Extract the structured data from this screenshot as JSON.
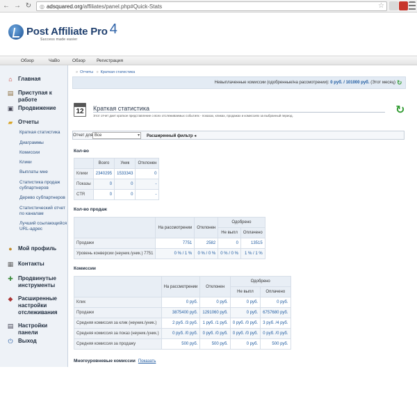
{
  "browser": {
    "url_host": "adsquared.org",
    "url_path": "/affiliates/panel.php#Quick-Stats",
    "back_glyph": "←",
    "forward_glyph": "→",
    "reload_glyph": "↻"
  },
  "header": {
    "logo_text": "Post Affiliate Pro",
    "logo_version": "4",
    "logo_tagline": "Success made easier",
    "nav": [
      "Обзор",
      "ЧаВо",
      "Обзор",
      "Регистрация"
    ]
  },
  "sidebar": {
    "items": [
      {
        "label": "Главная",
        "icon": "home-icon"
      },
      {
        "label": "Приступая к работе",
        "icon": "book-icon"
      },
      {
        "label": "Продвижение",
        "icon": "monitor-icon"
      },
      {
        "label": "Отчеты",
        "icon": "folder-icon"
      },
      {
        "label": "Мой профиль",
        "icon": "user-icon"
      },
      {
        "label": "Контакты",
        "icon": "contacts-icon"
      },
      {
        "label": "Продвинутые инструменты",
        "icon": "tools-icon"
      },
      {
        "label": "Расширенные настройки отслеживания",
        "icon": "tracking-icon"
      },
      {
        "label": "Настройки панели",
        "icon": "settings-icon"
      },
      {
        "label": "Выход",
        "icon": "logout-icon"
      }
    ],
    "reports_sub": [
      "Краткая статистика",
      "Диаграммы",
      "Комиссии",
      "Клики",
      "Выплаты мне",
      "Статистика продаж субпартнеров",
      "Дерево субпартнеров",
      "Статистический отчет по каналам",
      "Лучший ссылающийся URL-адрес"
    ]
  },
  "main": {
    "breadcrumb": [
      "Отчеты",
      "Краткая статистика"
    ],
    "pending_label": "Невыплаченные комиссии (одобренные/на рассмотрении):",
    "pending_value": "0 руб. / 101000 руб.",
    "pending_period": "(Этот месяц)",
    "calendar_day": "12",
    "title": "Краткая статистика",
    "description": "Этот отчет дает краткое представление о всех отслеживаемых событиях - показах, кликах, продажах и комиссиях за выбранный период.",
    "filter": {
      "label": "Отчет для",
      "selected": "Все",
      "advanced": "Расширенный фильтр"
    }
  },
  "counts": {
    "title": "Кол-во",
    "headers": [
      "Всего",
      "Уник",
      "Отклонен"
    ],
    "rows": [
      {
        "label": "Клики",
        "values": [
          "2340295",
          "1533343",
          "0"
        ]
      },
      {
        "label": "Показы",
        "values": [
          "0",
          "0",
          "-"
        ]
      },
      {
        "label": "CTR",
        "values": [
          "0",
          "0",
          "-"
        ]
      }
    ]
  },
  "sales": {
    "title": "Кол-во продаж",
    "headers": [
      "На рассмотрении",
      "Отклонен",
      "Одобрено",
      "Не выпл",
      "Оплачено"
    ],
    "rows": [
      {
        "label": "Продажи",
        "values": [
          "7751",
          "2582",
          "0",
          "13515"
        ]
      },
      {
        "label": "Уровень конверсии (неуник./уник.) 7751",
        "values": [
          "0 % / 1 %",
          "0 % / 0 %",
          "0 % / 0 %",
          "1 % / 1 %"
        ]
      }
    ]
  },
  "commissions": {
    "title": "Комиссии",
    "headers": [
      "На рассмотрении",
      "Отклонен",
      "Одобрено",
      "Не выпл",
      "Оплачено"
    ],
    "rows": [
      {
        "label": "Клик",
        "values": [
          "0 руб.",
          "0 руб.",
          "0 руб.",
          "0 руб."
        ]
      },
      {
        "label": "Продажи",
        "values": [
          "3875400 руб.",
          "1291060 руб.",
          "0 руб.",
          "6757680 руб."
        ]
      },
      {
        "label": "Средняя комиссия за клик (неуник./уник.)",
        "values": [
          "2 руб. /3 руб.",
          "1 руб. /1 руб.",
          "0 руб. /0 руб.",
          "3 руб. /4 руб."
        ]
      },
      {
        "label": "Средняя комиссия за показ (неуник./уник.)",
        "values": [
          "0 руб. /0 руб.",
          "0 руб. /0 руб.",
          "0 руб. /0 руб.",
          "0 руб. /0 руб."
        ]
      },
      {
        "label": "Средняя комиссия за продажу",
        "values": [
          "500 руб.",
          "500 руб.",
          "0 руб.",
          "500 руб."
        ]
      }
    ]
  },
  "multilevel": {
    "title": "Многоуровневые комиссии",
    "link": "Показать"
  }
}
